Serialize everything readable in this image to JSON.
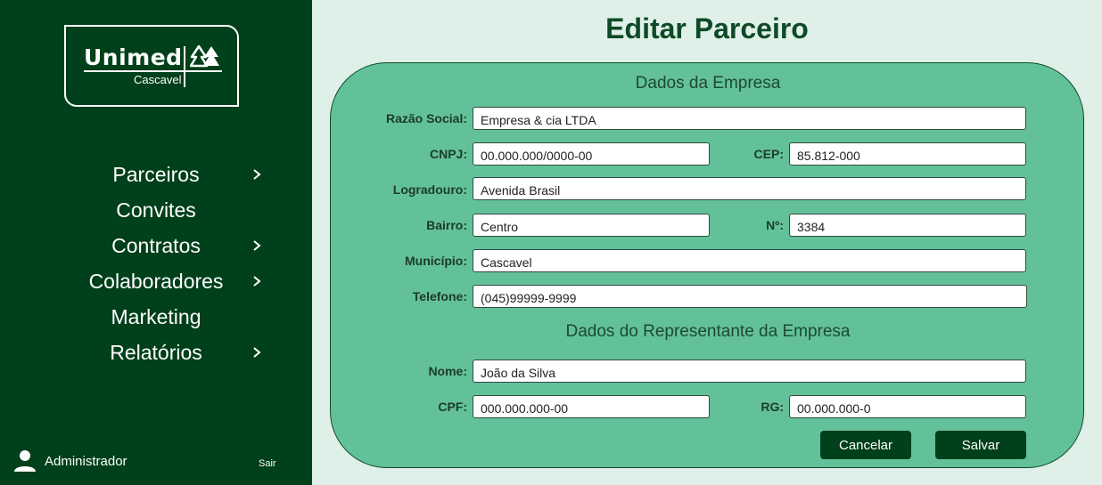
{
  "sidebar": {
    "logo": {
      "brand": "Unimed",
      "city": "Cascavel"
    },
    "nav": [
      {
        "label": "Parceiros",
        "has_submenu": true
      },
      {
        "label": "Convites",
        "has_submenu": false
      },
      {
        "label": "Contratos",
        "has_submenu": true
      },
      {
        "label": "Colaboradores",
        "has_submenu": true
      },
      {
        "label": "Marketing",
        "has_submenu": false
      },
      {
        "label": "Relatórios",
        "has_submenu": true
      }
    ],
    "user": {
      "name": "Administrador",
      "logout_label": "Sair"
    }
  },
  "page": {
    "title": "Editar Parceiro"
  },
  "form": {
    "company_section": "Dados da Empresa",
    "razao_social": {
      "label": "Razão Social:",
      "value": "Empresa & cia LTDA"
    },
    "cnpj": {
      "label": "CNPJ:",
      "value": "00.000.000/0000-00"
    },
    "cep": {
      "label": "CEP:",
      "value": "85.812-000"
    },
    "logradouro": {
      "label": "Logradouro:",
      "value": "Avenida Brasil"
    },
    "bairro": {
      "label": "Bairro:",
      "value": "Centro"
    },
    "numero": {
      "label": "Nº:",
      "value": "3384"
    },
    "municipio": {
      "label": "Município:",
      "value": "Cascavel"
    },
    "telefone": {
      "label": "Telefone:",
      "value": "(045)99999-9999"
    },
    "rep_section": "Dados do Representante da Empresa",
    "nome": {
      "label": "Nome:",
      "value": "João da Silva"
    },
    "cpf": {
      "label": "CPF:",
      "value": "000.000.000-00"
    },
    "rg": {
      "label": "RG:",
      "value": "00.000.000-0"
    },
    "cancel_label": "Cancelar",
    "save_label": "Salvar"
  },
  "colors": {
    "sidebar_bg": "#00401a",
    "content_bg": "#dff0e8",
    "card_bg": "#63c19a",
    "title": "#0e4a26",
    "button_bg": "#00401a"
  },
  "icons": {
    "logo_mark": "unimed-tree-icon",
    "submenu": "chevron-right-icon",
    "user": "user-icon"
  }
}
